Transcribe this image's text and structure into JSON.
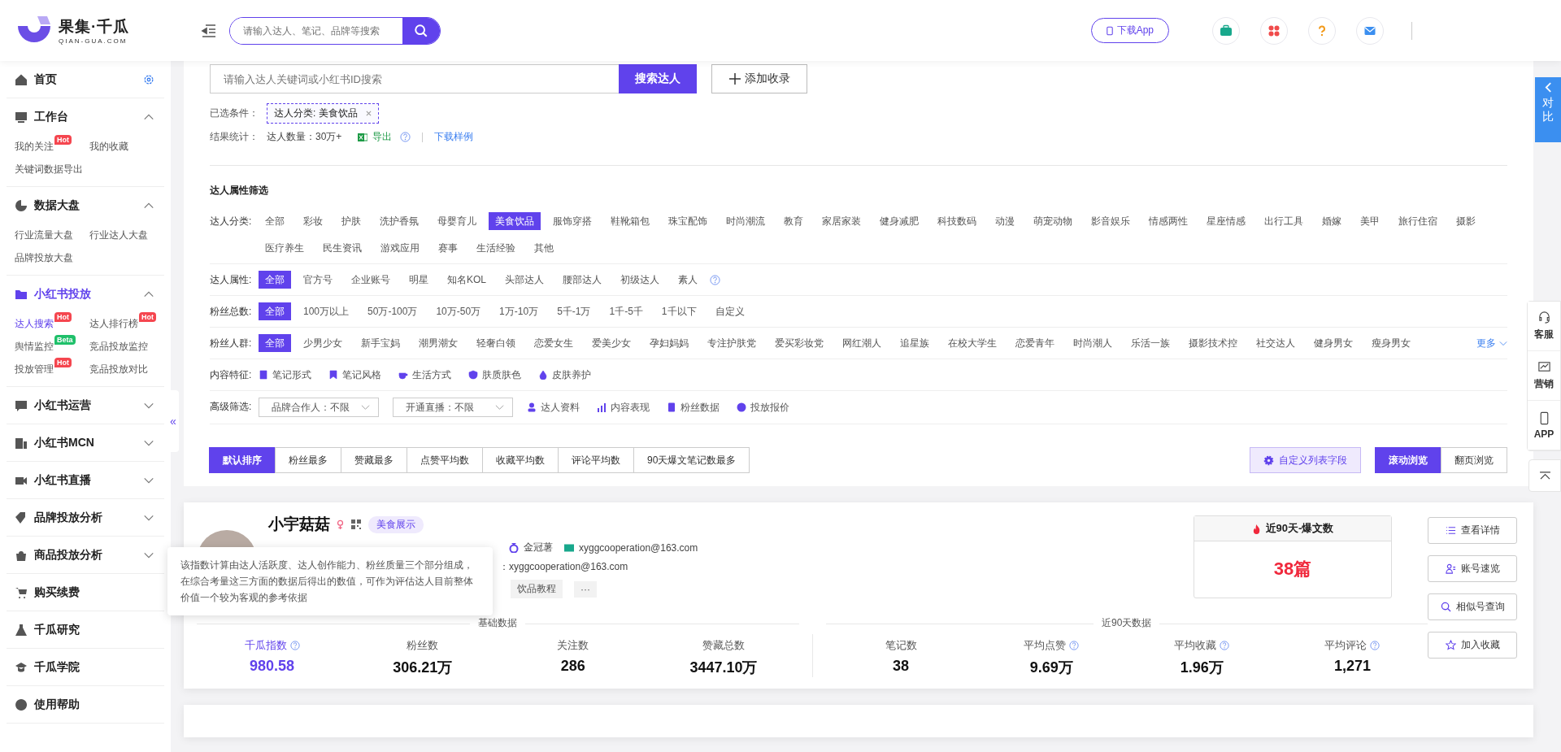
{
  "header": {
    "logo_title": "果集·千瓜",
    "logo_subtitle": "QIAN-GUA.COM",
    "search_placeholder": "请输入达人、笔记、品牌等搜索",
    "download_button": "下载App"
  },
  "sidebar": {
    "collapse": "«",
    "sections": [
      {
        "title": "首页",
        "kind": "home",
        "selected": false
      },
      {
        "title": "工作台",
        "kind": "group",
        "selected": false,
        "expanded": true,
        "children": [
          {
            "label": "我的关注",
            "badge": {
              "text": "Hot",
              "color": "#f5464f"
            },
            "selected": false
          },
          {
            "label": "我的收藏",
            "selected": false
          },
          {
            "label": "关键词数据导出",
            "selected": false
          }
        ]
      },
      {
        "title": "数据大盘",
        "kind": "group",
        "selected": false,
        "expanded": true,
        "children": [
          {
            "label": "行业流量大盘",
            "selected": false
          },
          {
            "label": "行业达人大盘",
            "selected": false
          },
          {
            "label": "品牌投放大盘",
            "selected": false
          }
        ]
      },
      {
        "title": "小红书投放",
        "kind": "group",
        "selected": true,
        "expanded": true,
        "children": [
          {
            "label": "达人搜索",
            "badge": {
              "text": "Hot",
              "color": "#f5464f"
            },
            "selected": true
          },
          {
            "label": "达人排行榜",
            "badge": {
              "text": "Hot",
              "color": "#f5464f"
            },
            "selected": false
          },
          {
            "label": "舆情监控",
            "badge": {
              "text": "Beta",
              "color": "#1fc06a"
            },
            "selected": false
          },
          {
            "label": "竞品投放监控",
            "selected": false
          },
          {
            "label": "投放管理",
            "badge": {
              "text": "Hot",
              "color": "#f5464f"
            },
            "selected": false
          },
          {
            "label": "竞品投放对比",
            "selected": false
          }
        ]
      },
      {
        "title": "小红书运营",
        "kind": "group",
        "selected": false,
        "expanded": false
      },
      {
        "title": "小红书MCN",
        "kind": "group",
        "selected": false,
        "expanded": false
      },
      {
        "title": "小红书直播",
        "kind": "group",
        "selected": false,
        "expanded": false
      },
      {
        "title": "品牌投放分析",
        "kind": "group",
        "selected": false,
        "expanded": false
      },
      {
        "title": "商品投放分析",
        "kind": "group",
        "selected": false,
        "expanded": false
      },
      {
        "title": "购买续费",
        "kind": "link",
        "selected": false
      },
      {
        "title": "千瓜研究",
        "kind": "link",
        "selected": false
      },
      {
        "title": "千瓜学院",
        "kind": "link",
        "selected": false
      },
      {
        "title": "使用帮助",
        "kind": "link",
        "selected": false
      }
    ]
  },
  "search": {
    "placeholder": "请输入达人关键词或小红书ID搜索",
    "button": "搜索达人",
    "add_button": "添加收录"
  },
  "selected_conditions": {
    "label": "已选条件：",
    "tags": [
      "达人分类: 美食饮品"
    ]
  },
  "result_stats": {
    "label": "结果统计：",
    "count": "达人数量：30万+",
    "export": "导出",
    "sample_link": "下载样例"
  },
  "filter_title": "达人属性筛选",
  "filter_rows": [
    {
      "label": "达人分类:",
      "kind": "options",
      "options": [
        {
          "label": "全部",
          "selected": false
        },
        {
          "label": "彩妆",
          "selected": false
        },
        {
          "label": "护肤",
          "selected": false
        },
        {
          "label": "洗护香氛",
          "selected": false
        },
        {
          "label": "母婴育儿",
          "selected": false
        },
        {
          "label": "美食饮品",
          "selected": true
        },
        {
          "label": "服饰穿搭",
          "selected": false
        },
        {
          "label": "鞋靴箱包",
          "selected": false
        },
        {
          "label": "珠宝配饰",
          "selected": false
        },
        {
          "label": "时尚潮流",
          "selected": false
        },
        {
          "label": "教育",
          "selected": false
        },
        {
          "label": "家居家装",
          "selected": false
        },
        {
          "label": "健身减肥",
          "selected": false
        },
        {
          "label": "科技数码",
          "selected": false
        },
        {
          "label": "动漫",
          "selected": false
        },
        {
          "label": "萌宠动物",
          "selected": false
        },
        {
          "label": "影音娱乐",
          "selected": false
        },
        {
          "label": "情感两性",
          "selected": false
        },
        {
          "label": "星座情感",
          "selected": false
        },
        {
          "label": "出行工具",
          "selected": false
        },
        {
          "label": "婚嫁",
          "selected": false
        },
        {
          "label": "美甲",
          "selected": false
        },
        {
          "label": "旅行住宿",
          "selected": false
        },
        {
          "label": "摄影",
          "selected": false
        },
        {
          "label": "医疗养生",
          "selected": false
        },
        {
          "label": "民生资讯",
          "selected": false
        },
        {
          "label": "游戏应用",
          "selected": false
        },
        {
          "label": "赛事",
          "selected": false
        },
        {
          "label": "生活经验",
          "selected": false
        },
        {
          "label": "其他",
          "selected": false
        }
      ]
    },
    {
      "label": "达人属性:",
      "kind": "options",
      "help": true,
      "options": [
        {
          "label": "全部",
          "selected": true
        },
        {
          "label": "官方号",
          "selected": false
        },
        {
          "label": "企业账号",
          "selected": false
        },
        {
          "label": "明星",
          "selected": false
        },
        {
          "label": "知名KOL",
          "selected": false
        },
        {
          "label": "头部达人",
          "selected": false
        },
        {
          "label": "腰部达人",
          "selected": false
        },
        {
          "label": "初级达人",
          "selected": false
        },
        {
          "label": "素人",
          "selected": false
        }
      ]
    },
    {
      "label": "粉丝总数:",
      "kind": "options",
      "options": [
        {
          "label": "全部",
          "selected": true
        },
        {
          "label": "100万以上",
          "selected": false
        },
        {
          "label": "50万-100万",
          "selected": false
        },
        {
          "label": "10万-50万",
          "selected": false
        },
        {
          "label": "1万-10万",
          "selected": false
        },
        {
          "label": "5千-1万",
          "selected": false
        },
        {
          "label": "1千-5千",
          "selected": false
        },
        {
          "label": "1千以下",
          "selected": false
        },
        {
          "label": "自定义",
          "selected": false
        }
      ]
    },
    {
      "label": "粉丝人群:",
      "kind": "options",
      "more": "更多",
      "options": [
        {
          "label": "全部",
          "selected": true
        },
        {
          "label": "少男少女",
          "selected": false
        },
        {
          "label": "新手宝妈",
          "selected": false
        },
        {
          "label": "潮男潮女",
          "selected": false
        },
        {
          "label": "轻奢白领",
          "selected": false
        },
        {
          "label": "恋爱女生",
          "selected": false
        },
        {
          "label": "爱美少女",
          "selected": false
        },
        {
          "label": "孕妇妈妈",
          "selected": false
        },
        {
          "label": "专注护肤党",
          "selected": false
        },
        {
          "label": "爱买彩妆党",
          "selected": false
        },
        {
          "label": "网红潮人",
          "selected": false
        },
        {
          "label": "追星族",
          "selected": false
        },
        {
          "label": "在校大学生",
          "selected": false
        },
        {
          "label": "恋爱青年",
          "selected": false
        },
        {
          "label": "时尚潮人",
          "selected": false
        },
        {
          "label": "乐活一族",
          "selected": false
        },
        {
          "label": "摄影技术控",
          "selected": false
        },
        {
          "label": "社交达人",
          "selected": false
        },
        {
          "label": "健身男女",
          "selected": false
        },
        {
          "label": "瘦身男女",
          "selected": false
        }
      ]
    },
    {
      "label": "内容特征:",
      "kind": "features",
      "options": [
        {
          "label": "笔记形式",
          "selected": false
        },
        {
          "label": "笔记风格",
          "selected": false
        },
        {
          "label": "生活方式",
          "selected": false
        },
        {
          "label": "肤质肤色",
          "selected": false
        },
        {
          "label": "皮肤养护",
          "selected": false
        }
      ]
    },
    {
      "label": "高级筛选:",
      "kind": "advanced",
      "dropdowns": [
        "品牌合作人：不限",
        "开通直播：不限"
      ],
      "options": [
        {
          "label": "达人资料",
          "selected": false
        },
        {
          "label": "内容表现",
          "selected": false
        },
        {
          "label": "粉丝数据",
          "selected": false
        },
        {
          "label": "投放报价",
          "selected": false
        }
      ]
    }
  ],
  "sort_tabs": [
    {
      "label": "默认排序",
      "selected": true
    },
    {
      "label": "粉丝最多",
      "selected": false
    },
    {
      "label": "赞藏最多",
      "selected": false
    },
    {
      "label": "点赞平均数",
      "selected": false
    },
    {
      "label": "收藏平均数",
      "selected": false
    },
    {
      "label": "评论平均数",
      "selected": false
    },
    {
      "label": "90天爆文笔记数最多",
      "selected": false
    }
  ],
  "custom_fields_button": "自定义列表字段",
  "view_modes": [
    {
      "label": "滚动浏览",
      "selected": true
    },
    {
      "label": "翻页浏览",
      "selected": false
    }
  ],
  "creator": {
    "name": "小宇菇菇",
    "category_tag": "美食展示",
    "attributes": [
      "金冠薯",
      "xyggcooperation@163.com"
    ],
    "contact": "：xyggcooperation@163.com",
    "tags": [
      "饮品教程",
      "···"
    ],
    "tooltip": "该指数计算由达人活跃度、达人创作能力、粉丝质量三个部分组成，在综合考量这三方面的数据后得出的数值，可作为评估达人目前整体价值一个较为客观的参考依据",
    "basic_title": "基础数据",
    "recent_title": "近90天数据",
    "basic_stats": [
      {
        "label": "千瓜指数",
        "value": "980.58",
        "help": true,
        "highlight": true
      },
      {
        "label": "粉丝数",
        "value": "306.21万",
        "highlight": false
      },
      {
        "label": "关注数",
        "value": "286",
        "highlight": false
      },
      {
        "label": "赞藏总数",
        "value": "3447.10万",
        "highlight": false
      }
    ],
    "recent_stats": [
      {
        "label": "笔记数",
        "value": "38",
        "highlight": false
      },
      {
        "label": "平均点赞",
        "value": "9.69万",
        "help": true,
        "highlight": false
      },
      {
        "label": "平均收藏",
        "value": "1.96万",
        "help": true,
        "highlight": false
      },
      {
        "label": "平均评论",
        "value": "1,271",
        "help": true,
        "highlight": false
      }
    ],
    "hot_box": {
      "title": "近90天-爆文数",
      "value": "38篇"
    },
    "actions": [
      "查看详情",
      "账号速览",
      "相似号查询",
      "加入收藏"
    ]
  },
  "right_rail": {
    "compare": "对比",
    "tools": [
      "客服",
      "营销",
      "APP"
    ]
  }
}
